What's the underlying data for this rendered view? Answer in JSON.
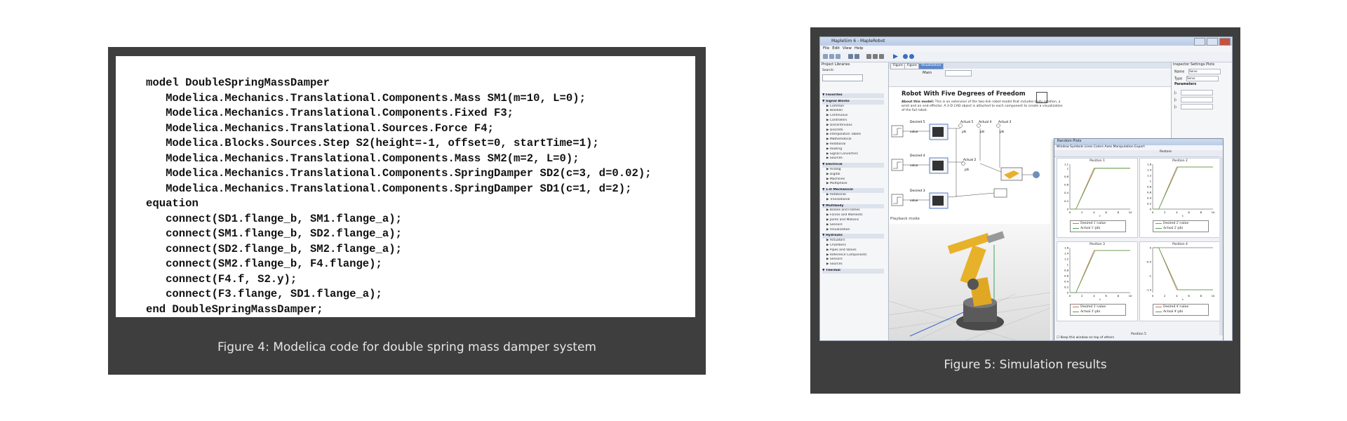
{
  "figure4": {
    "code_lines": [
      "model DoubleSpringMassDamper",
      "   Modelica.Mechanics.Translational.Components.Mass SM1(m=10, L=0);",
      "   Modelica.Mechanics.Translational.Components.Fixed F3;",
      "   Modelica.Mechanics.Translational.Sources.Force F4;",
      "   Modelica.Blocks.Sources.Step S2(height=-1, offset=0, startTime=1);",
      "   Modelica.Mechanics.Translational.Components.Mass SM2(m=2, L=0);",
      "   Modelica.Mechanics.Translational.Components.SpringDamper SD2(c=3, d=0.02);",
      "   Modelica.Mechanics.Translational.Components.SpringDamper SD1(c=1, d=2);",
      "equation",
      "   connect(SD1.flange_b, SM1.flange_a);",
      "   connect(SM1.flange_b, SD2.flange_a);",
      "   connect(SD2.flange_b, SM2.flange_a);",
      "   connect(SM2.flange_b, F4.flange);",
      "   connect(F4.f, S2.y);",
      "   connect(F3.flange, SD1.flange_a);",
      "end DoubleSpringMassDamper;"
    ],
    "caption": "Figure 4: Modelica code for double spring mass damper system"
  },
  "figure5": {
    "caption": "Figure 5: Simulation results",
    "app": {
      "title": "MapleSim 6 - MapleRobot",
      "menu": [
        "File",
        "Edit",
        "View",
        "Help"
      ],
      "left_tabs": [
        "Project",
        "Libraries"
      ],
      "search_label": "Search:",
      "library": [
        {
          "h": "Favorites",
          "items": []
        },
        {
          "h": "Signal Blocks",
          "items": [
            "Common",
            "Boolean",
            "Continuous",
            "Controllers",
            "Discontinuous",
            "Discrete",
            "Interpolation Tables",
            "Mathematical",
            "Relational",
            "Routing",
            "Signal Converters",
            "Sources"
          ]
        },
        {
          "h": "Electrical",
          "items": [
            "Analog",
            "Digital",
            "Machines",
            "Multiphase"
          ]
        },
        {
          "h": "1-D Mechanical",
          "items": [
            "Rotational",
            "Translational"
          ]
        },
        {
          "h": "Multibody",
          "items": [
            "Bodies and Frames",
            "Forces and Moments",
            "Joints and Motions",
            "Sensors",
            "Visualization"
          ]
        },
        {
          "h": "Hydraulic",
          "items": [
            "Actuators",
            "Chambers",
            "Pipes and Valves",
            "Reference Components",
            "Sensors",
            "Sources"
          ]
        },
        {
          "h": "Thermal",
          "items": []
        }
      ],
      "doc_tabs": [
        "Figure 3",
        "Figure 1",
        "Visualization"
      ],
      "main_label": "Main",
      "doc_title": "Robot With Five Degrees of Freedom",
      "doc_text_bold": "About this model:",
      "doc_text": "This is an extension of the two-link robot model that includes body rotation, a wrist and an end effector. A 3-D CAD object is attached to each component to create a visualization of the full robot.",
      "blocks": [
        "Desired 5",
        "Actual 5",
        "Actual 4",
        "Actual 3",
        "Desired 4",
        "Desired 3",
        "Actual 2"
      ],
      "block_ports": [
        "value",
        "phi"
      ],
      "playback": "Playback mode",
      "right_tabs": [
        "Inspector",
        "Settings",
        "Plots"
      ],
      "inspector": [
        {
          "k": "Name",
          "v": "Servo"
        },
        {
          "k": "Type",
          "v": "Servo"
        }
      ],
      "parameters_label": "Parameters",
      "param_rows": [
        "J₁",
        "J₂",
        "J₃"
      ]
    },
    "plot_window": {
      "title": "Random Plots",
      "menu": [
        "Window",
        "Symbols",
        "Lines",
        "Colors",
        "Axes",
        "Manipulation",
        "Export"
      ],
      "tool_label": "Restore",
      "footer": "Keep this window on top of others",
      "color_desired": "#e06a52",
      "color_actual": "#4aa44a",
      "plots": [
        {
          "title": "Position 1",
          "legend": [
            "Desired 1':value",
            "Actual 1':phi"
          ],
          "ylim": [
            0,
            1.1
          ],
          "yticks": [
            "1.1",
            "1",
            "0.8",
            "0.6",
            "0.4",
            "0.2",
            "0"
          ],
          "xticks": [
            "0",
            "2",
            "4",
            "6",
            "8",
            "10"
          ],
          "xlabel": "t",
          "chart_data": {
            "type": "line",
            "x": [
              0,
              1,
              4,
              10
            ],
            "desired": [
              0,
              0,
              1,
              1
            ],
            "actual": [
              0,
              0,
              1,
              1
            ]
          }
        },
        {
          "title": "Position 2",
          "legend": [
            "Desired 2':value",
            "Actual 2':phi"
          ],
          "ylim": [
            0,
            1.6
          ],
          "yticks": [
            "1.6",
            "1.4",
            "1.2",
            "1",
            "0.8",
            "0.6",
            "0.4",
            "0.2",
            "0"
          ],
          "xticks": [
            "0",
            "2",
            "4",
            "6",
            "8",
            "10"
          ],
          "xlabel": "t",
          "chart_data": {
            "type": "line",
            "x": [
              0,
              1,
              4,
              10
            ],
            "desired": [
              0,
              0,
              1.5,
              1.5
            ],
            "actual": [
              0,
              0,
              1.5,
              1.5
            ]
          }
        },
        {
          "title": "Position 3",
          "legend": [
            "Desired 3':value",
            "Actual 3':phi"
          ],
          "ylim": [
            0,
            1.6
          ],
          "yticks": [
            "1.6",
            "1.4",
            "1.2",
            "1",
            "0.8",
            "0.6",
            "0.4",
            "0.2",
            "0"
          ],
          "xticks": [
            "0",
            "2",
            "4",
            "6",
            "8",
            "10"
          ],
          "xlabel": "t",
          "chart_data": {
            "type": "line",
            "x": [
              0,
              1,
              4,
              10
            ],
            "desired": [
              0,
              0,
              1.5,
              1.5
            ],
            "actual": [
              0,
              0,
              1.5,
              1.5
            ]
          }
        },
        {
          "title": "Position 4",
          "legend": [
            "Desired 4':value",
            "Actual 4':phi"
          ],
          "ylim": [
            -1.6,
            0
          ],
          "yticks": [
            "0",
            "-0.5",
            "-1",
            "-1.5"
          ],
          "xticks": [
            "0",
            "2",
            "4",
            "6",
            "8",
            "10"
          ],
          "xlabel": "t",
          "chart_data": {
            "type": "line",
            "x": [
              0,
              1,
              4,
              10
            ],
            "desired": [
              0,
              0,
              -1.5,
              -1.5
            ],
            "actual": [
              0,
              0,
              -1.5,
              -1.5
            ]
          }
        }
      ],
      "next_plot_title": "Position 5"
    }
  }
}
